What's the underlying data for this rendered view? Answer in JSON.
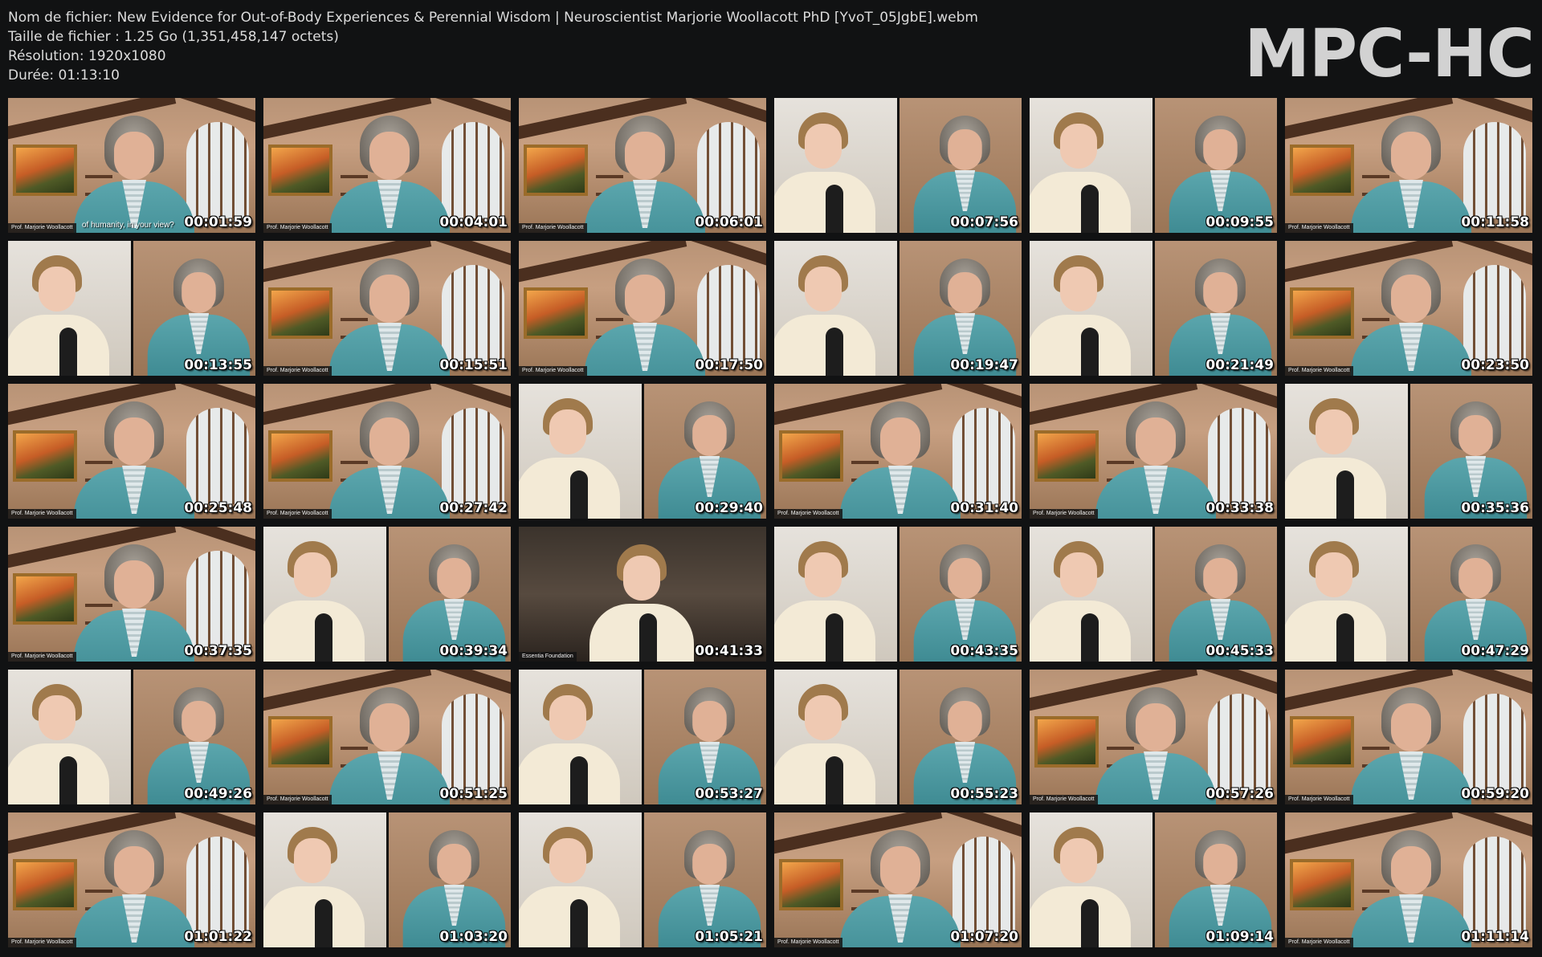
{
  "header": {
    "filename": "Nom de fichier: New Evidence for Out-of-Body Experiences & Perennial Wisdom  |  Neuroscientist Marjorie Woollacott PhD [YvoT_05JgbE].webm",
    "filesize": "Taille de fichier : 1.25 Go (1,351,458,147 octets)",
    "resolution": "Résolution: 1920x1080",
    "duration": "Durée: 01:13:10"
  },
  "logo": "MPC-HC",
  "thumbnails": [
    {
      "ts": "00:01:59",
      "scene": "room",
      "label": "Prof. Marjorie Woollacott",
      "caption": "of humanity, in your view?"
    },
    {
      "ts": "00:04:01",
      "scene": "room",
      "label": "Prof. Marjorie Woollacott"
    },
    {
      "ts": "00:06:01",
      "scene": "room",
      "label": "Prof. Marjorie Woollacott"
    },
    {
      "ts": "00:07:56",
      "scene": "split"
    },
    {
      "ts": "00:09:55",
      "scene": "split"
    },
    {
      "ts": "00:11:58",
      "scene": "room",
      "label": "Prof. Marjorie Woollacott"
    },
    {
      "ts": "00:13:55",
      "scene": "split"
    },
    {
      "ts": "00:15:51",
      "scene": "room",
      "label": "Prof. Marjorie Woollacott"
    },
    {
      "ts": "00:17:50",
      "scene": "room",
      "label": "Prof. Marjorie Woollacott"
    },
    {
      "ts": "00:19:47",
      "scene": "split"
    },
    {
      "ts": "00:21:49",
      "scene": "split"
    },
    {
      "ts": "00:23:50",
      "scene": "room",
      "label": "Prof. Marjorie Woollacott"
    },
    {
      "ts": "00:25:48",
      "scene": "room",
      "label": "Prof. Marjorie Woollacott"
    },
    {
      "ts": "00:27:42",
      "scene": "room",
      "label": "Prof. Marjorie Woollacott"
    },
    {
      "ts": "00:29:40",
      "scene": "split"
    },
    {
      "ts": "00:31:40",
      "scene": "room",
      "label": "Prof. Marjorie Woollacott"
    },
    {
      "ts": "00:33:38",
      "scene": "room",
      "label": "Prof. Marjorie Woollacott"
    },
    {
      "ts": "00:35:36",
      "scene": "split"
    },
    {
      "ts": "00:37:35",
      "scene": "room",
      "label": "Prof. Marjorie Woollacott"
    },
    {
      "ts": "00:39:34",
      "scene": "split"
    },
    {
      "ts": "00:41:33",
      "scene": "dark",
      "label": "Essentia Foundation"
    },
    {
      "ts": "00:43:35",
      "scene": "split"
    },
    {
      "ts": "00:45:33",
      "scene": "split"
    },
    {
      "ts": "00:47:29",
      "scene": "split"
    },
    {
      "ts": "00:49:26",
      "scene": "split"
    },
    {
      "ts": "00:51:25",
      "scene": "room",
      "label": "Prof. Marjorie Woollacott"
    },
    {
      "ts": "00:53:27",
      "scene": "split"
    },
    {
      "ts": "00:55:23",
      "scene": "split"
    },
    {
      "ts": "00:57:26",
      "scene": "room",
      "label": "Prof. Marjorie Woollacott"
    },
    {
      "ts": "00:59:20",
      "scene": "room",
      "label": "Prof. Marjorie Woollacott"
    },
    {
      "ts": "01:01:22",
      "scene": "room",
      "label": "Prof. Marjorie Woollacott"
    },
    {
      "ts": "01:03:20",
      "scene": "split"
    },
    {
      "ts": "01:05:21",
      "scene": "split"
    },
    {
      "ts": "01:07:20",
      "scene": "room",
      "label": "Prof. Marjorie Woollacott"
    },
    {
      "ts": "01:09:14",
      "scene": "split"
    },
    {
      "ts": "01:11:14",
      "scene": "room",
      "label": "Prof. Marjorie Woollacott"
    }
  ]
}
